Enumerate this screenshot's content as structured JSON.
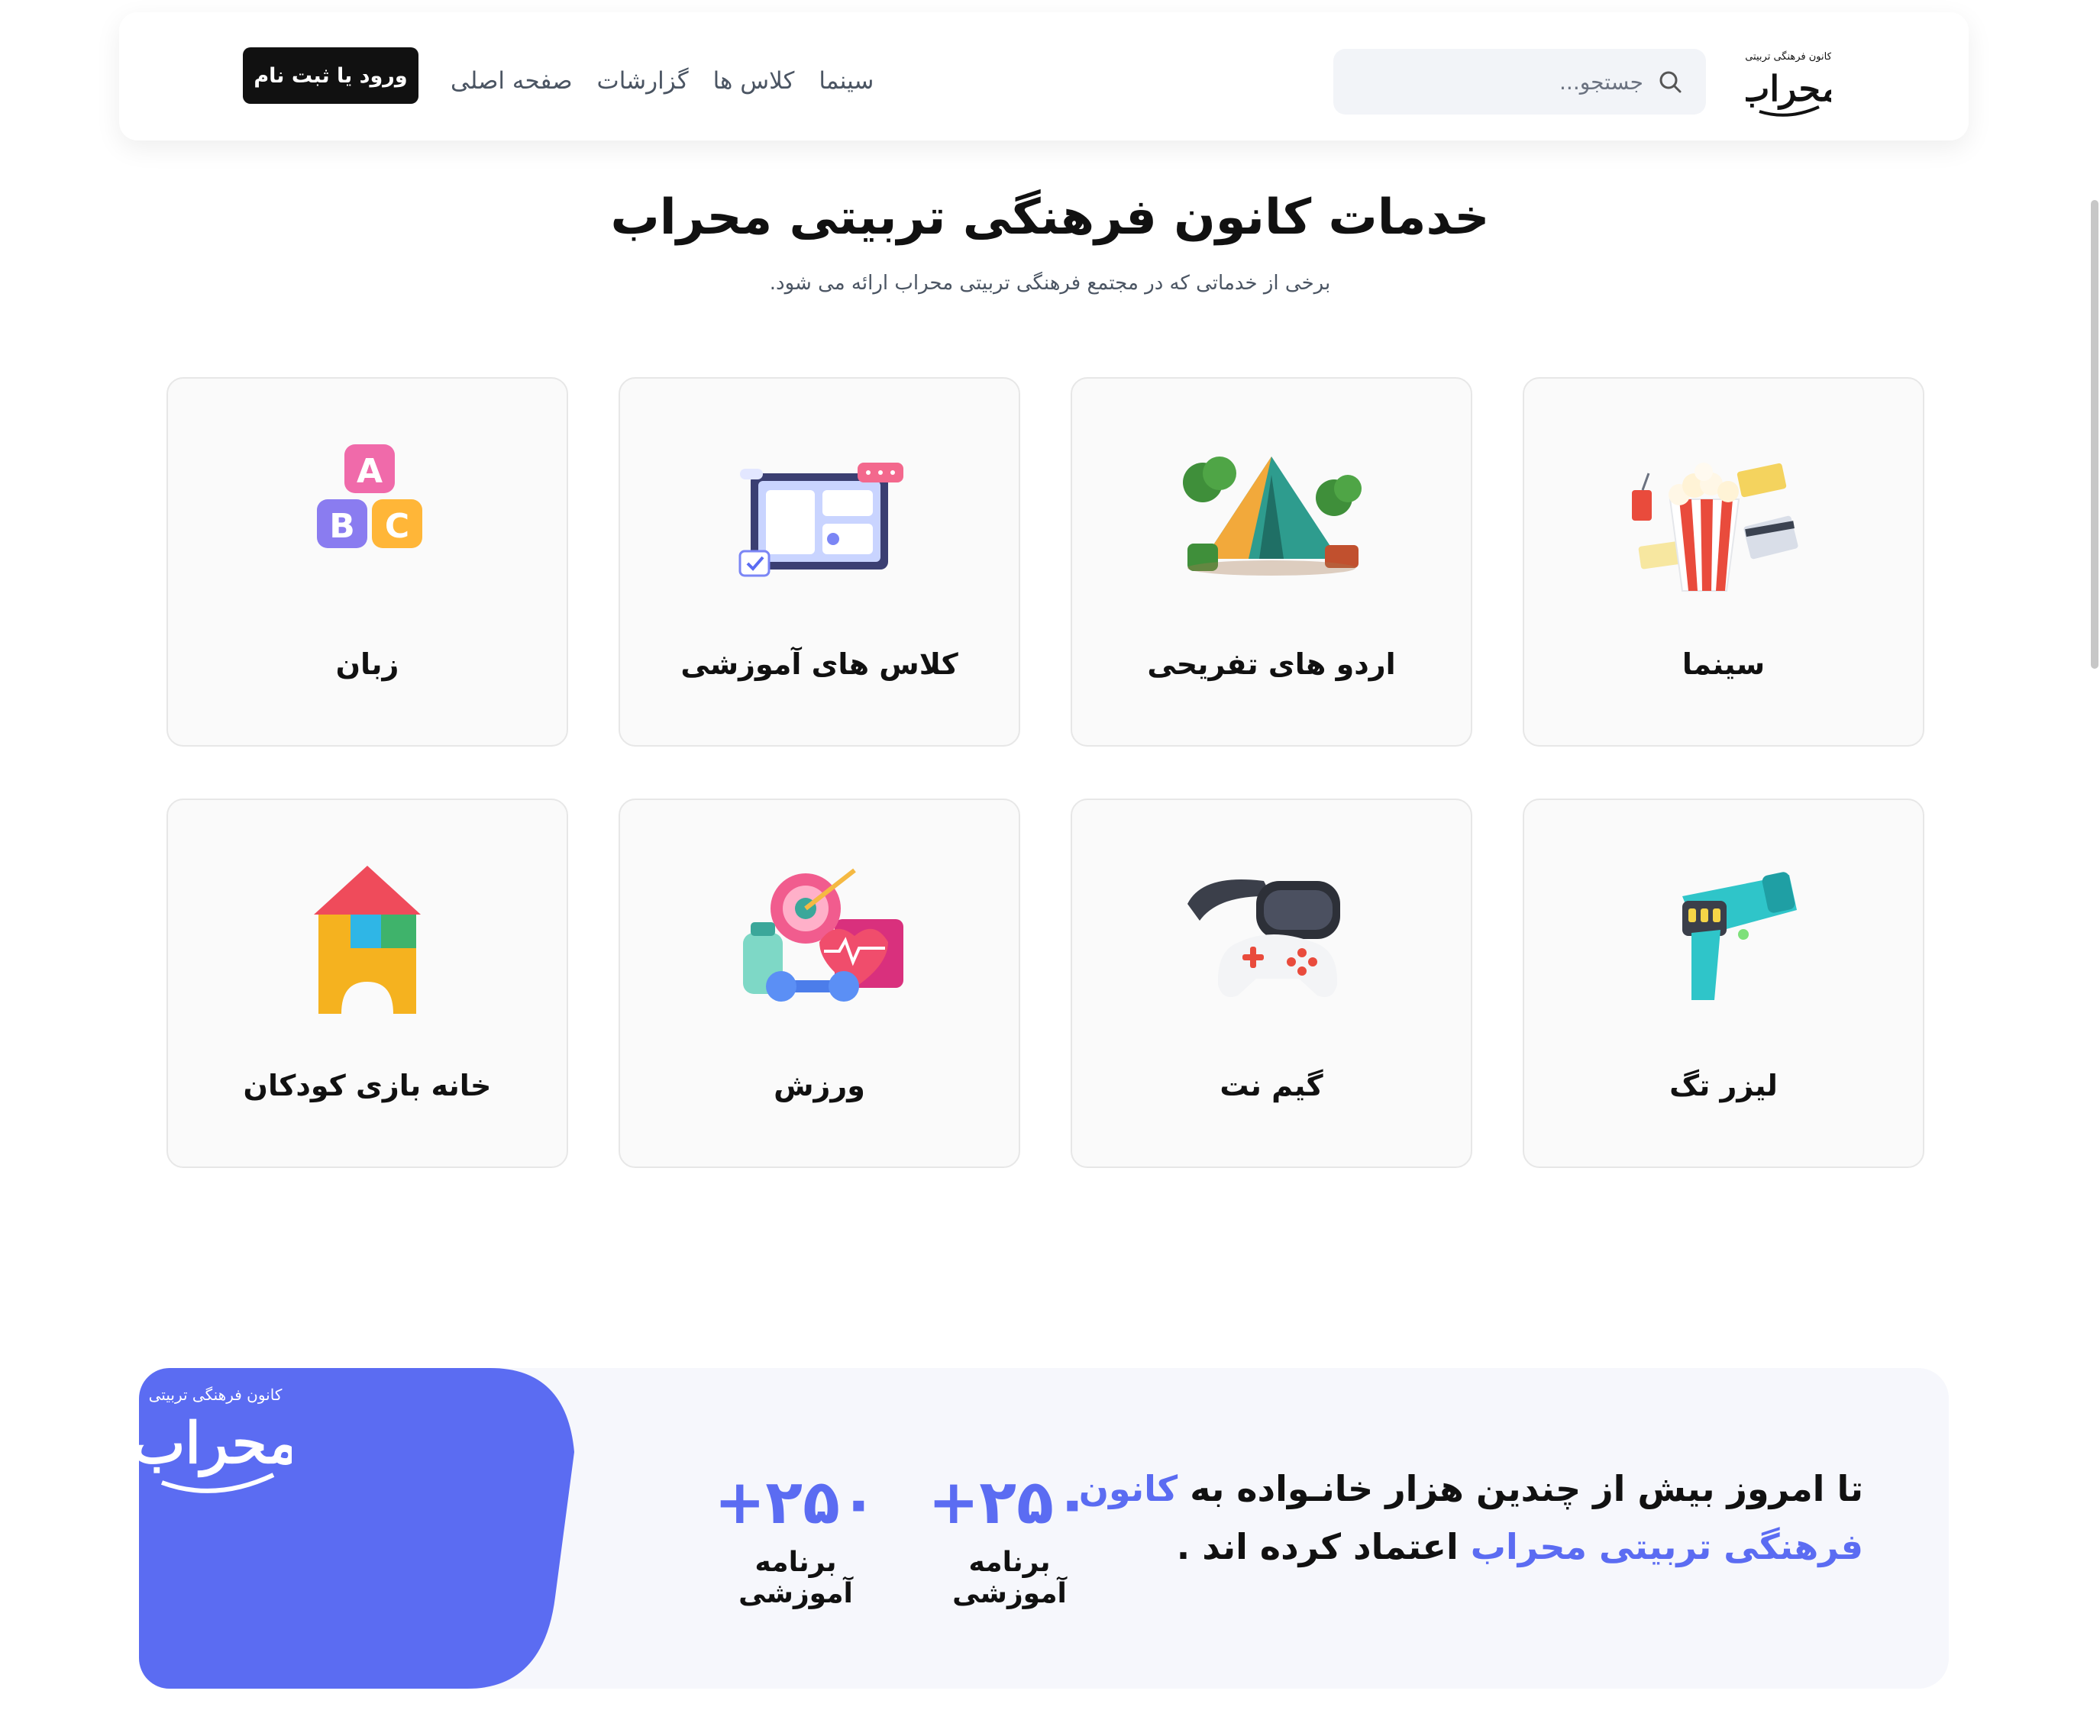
{
  "header": {
    "logo_alt": "محراب",
    "search": {
      "placeholder": "جستجو..."
    },
    "nav": [
      {
        "label": "سینما"
      },
      {
        "label": "کلاس ها"
      },
      {
        "label": "گزارشات"
      },
      {
        "label": "صفحه اصلی"
      }
    ],
    "login_label": "ورود یا ثبت نام"
  },
  "services": {
    "title": "خدمات کانون فرهنگی تربیتی محراب",
    "subtitle": "برخی از خدماتی که در مجتمع فرهنگی تربیتی محراب ارائه می شود.",
    "items": [
      {
        "label": "سینما",
        "icon": "popcorn-cinema-icon"
      },
      {
        "label": "اردو های تفریحی",
        "icon": "camping-tent-icon"
      },
      {
        "label": "کلاس های آموزشی",
        "icon": "online-class-icon"
      },
      {
        "label": "زبان",
        "icon": "abc-blocks-icon"
      },
      {
        "label": "لیزر تگ",
        "icon": "laser-gun-icon"
      },
      {
        "label": "گیم نت",
        "icon": "vr-gamepad-icon"
      },
      {
        "label": "ورزش",
        "icon": "fitness-icon"
      },
      {
        "label": "خانه بازی کودکان",
        "icon": "toy-house-icon"
      }
    ]
  },
  "banner": {
    "text_part1": "تا امروز بیش از چندین هزار خانـواده به ",
    "text_highlight": "کانون فرهنگی تربیتی محراب",
    "text_part2": " اعتماد کرده اند .",
    "stats": [
      {
        "value": "+۲۵۰",
        "caption": "برنامه آموزشی"
      },
      {
        "value": "+۲۵۰",
        "caption": "برنامه آموزشی"
      }
    ],
    "accent_color": "#5b6cf2",
    "logo_top_text": "کانون فرهنگی تربیتی",
    "logo_main_text": "محراب"
  },
  "colors": {
    "accent": "#5b6cf2",
    "button_dark": "#111111"
  }
}
